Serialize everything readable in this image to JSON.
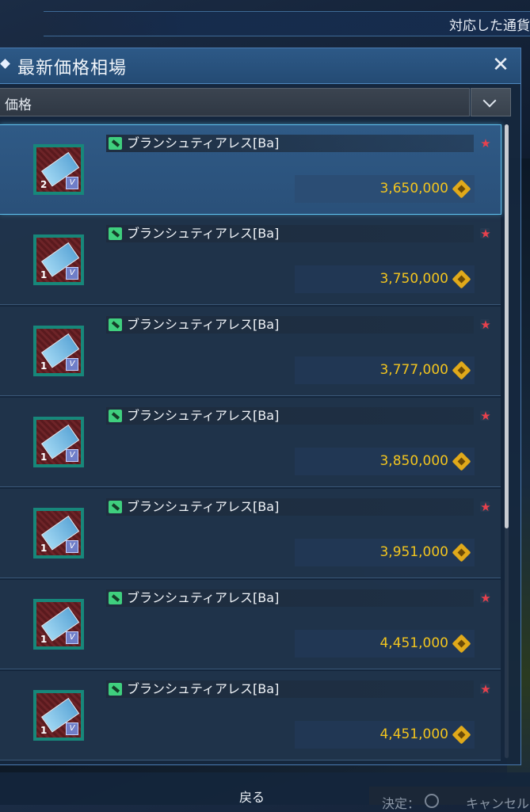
{
  "top_banner": {
    "text": "対応した通貨"
  },
  "window": {
    "title": "最新価格相場",
    "close_label": "✕"
  },
  "sort": {
    "selected": "価格"
  },
  "listings": [
    {
      "name": "ブランシュティアレス[Ba]",
      "quantity": "2",
      "price": "3,650,000",
      "selected": true
    },
    {
      "name": "ブランシュティアレス[Ba]",
      "quantity": "1",
      "price": "3,750,000",
      "selected": false
    },
    {
      "name": "ブランシュティアレス[Ba]",
      "quantity": "1",
      "price": "3,777,000",
      "selected": false
    },
    {
      "name": "ブランシュティアレス[Ba]",
      "quantity": "1",
      "price": "3,850,000",
      "selected": false
    },
    {
      "name": "ブランシュティアレス[Ba]",
      "quantity": "1",
      "price": "3,951,000",
      "selected": false
    },
    {
      "name": "ブランシュティアレス[Ba]",
      "quantity": "1",
      "price": "4,451,000",
      "selected": false
    },
    {
      "name": "ブランシュティアレス[Ba]",
      "quantity": "1",
      "price": "4,451,000",
      "selected": false
    }
  ],
  "footer": {
    "back_label": "戻る",
    "confirm_hint": "決定：",
    "cancel_hint": "キャンセル"
  },
  "colors": {
    "price": "#f3c51e",
    "selection_border": "#5fc0ee",
    "thumb_frame": "#17877a"
  }
}
